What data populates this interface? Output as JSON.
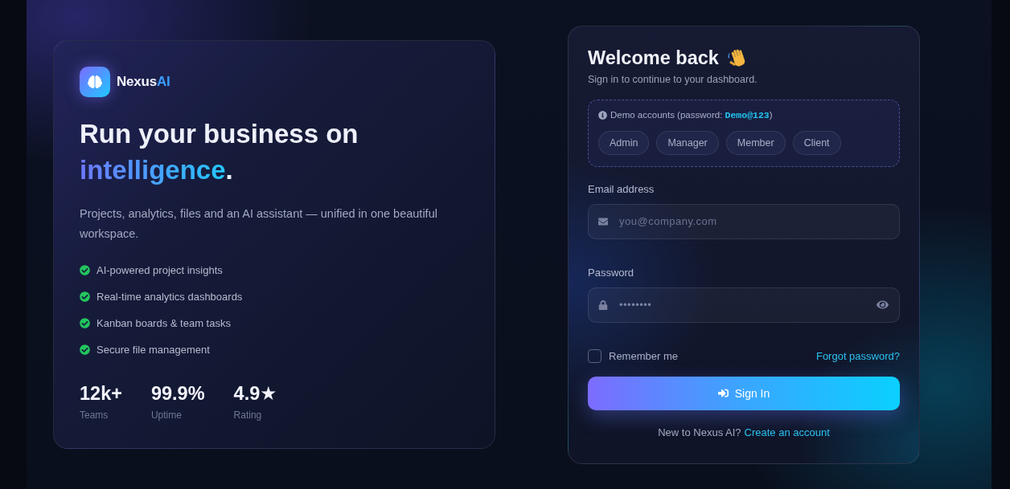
{
  "brand": {
    "name": "Nexus",
    "accent": "AI"
  },
  "hero": {
    "headline": "Run your business on",
    "highlight": "intelligence",
    "end": ".",
    "description": "Projects, analytics, files and an AI assistant — unified in one beautiful workspace."
  },
  "features": [
    "AI-powered project insights",
    "Real-time analytics dashboards",
    "Kanban boards & team tasks",
    "Secure file management"
  ],
  "stats": [
    {
      "value": "12k+",
      "label": "Teams"
    },
    {
      "value": "99.9%",
      "label": "Uptime"
    },
    {
      "value": "4.9★",
      "label": "Rating"
    }
  ],
  "login": {
    "title": "Welcome back",
    "subtitle": "Sign in to continue to your dashboard.",
    "demo": {
      "prefix": "Demo accounts (password: ",
      "password": "Demo@123",
      "suffix": ")",
      "accounts": [
        "Admin",
        "Manager",
        "Member",
        "Client"
      ]
    },
    "email": {
      "label": "Email address",
      "placeholder": "you@company.com"
    },
    "password": {
      "label": "Password",
      "value": "••••••••"
    },
    "remember": {
      "label": "Remember me",
      "checked": false
    },
    "forgot_link": "Forgot password?",
    "submit": "Sign In",
    "signup": {
      "prompt": "New to Nexus AI?",
      "link": "Create an account"
    }
  }
}
